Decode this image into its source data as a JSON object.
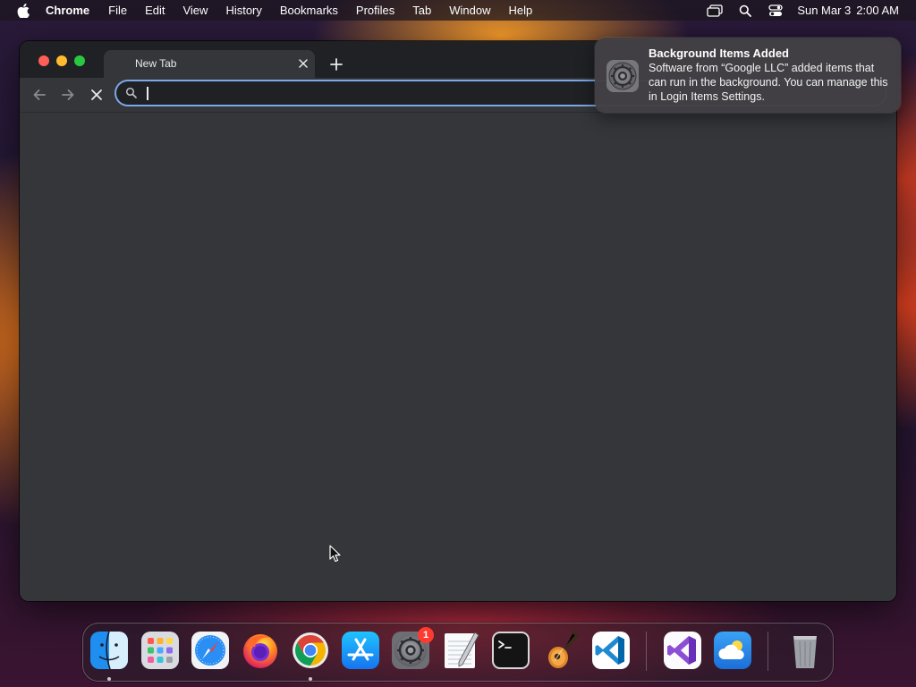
{
  "menubar": {
    "app_name": "Chrome",
    "items": [
      "File",
      "Edit",
      "View",
      "History",
      "Bookmarks",
      "Profiles",
      "Tab",
      "Window",
      "Help"
    ],
    "date": "Sun Mar 3",
    "time": "2:00 AM"
  },
  "browser": {
    "tab_title": "New Tab",
    "omnibox": {
      "value": "",
      "placeholder": ""
    }
  },
  "notification": {
    "title": "Background Items Added",
    "body": "Software from “Google LLC” added items that can run in the background. You can manage this in Login Items Settings."
  },
  "dock": {
    "items": [
      {
        "name": "finder-icon",
        "running": true
      },
      {
        "name": "launchpad-icon",
        "running": false
      },
      {
        "name": "safari-icon",
        "running": false
      },
      {
        "name": "firefox-icon",
        "running": false
      },
      {
        "name": "chrome-icon",
        "running": true
      },
      {
        "name": "app-store-icon",
        "running": false
      },
      {
        "name": "system-settings-icon",
        "running": false,
        "badge": "1"
      },
      {
        "name": "textedit-icon",
        "running": false
      },
      {
        "name": "terminal-icon",
        "running": false
      },
      {
        "name": "garageband-icon",
        "running": false
      },
      {
        "name": "vscode-icon",
        "running": false
      },
      {
        "name": "visual-studio-icon",
        "running": false
      },
      {
        "name": "weather-icon",
        "running": false
      },
      {
        "name": "trash-icon",
        "running": false
      }
    ]
  }
}
